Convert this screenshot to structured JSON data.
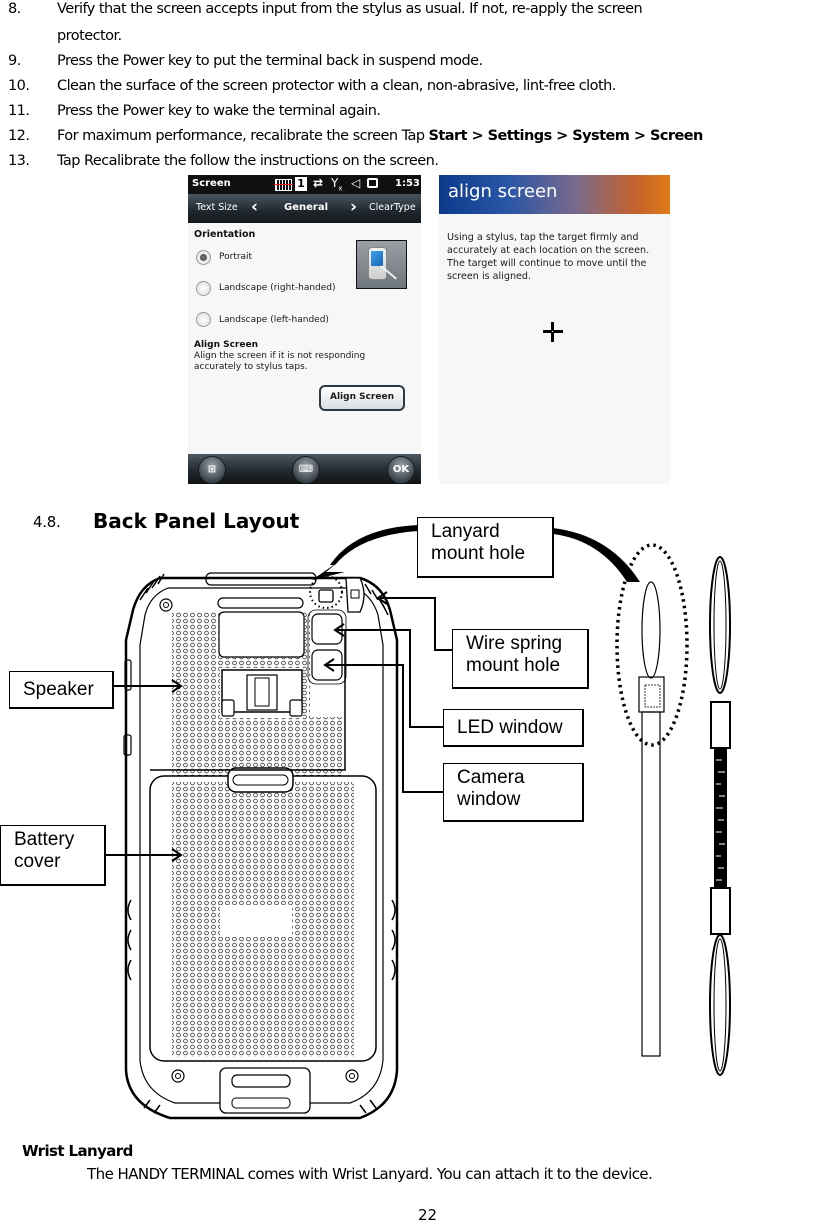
{
  "steps": [
    {
      "num": "8.",
      "lines": [
        "Verify that the screen accepts input from the stylus as usual. If not, re-apply the screen",
        "protector."
      ]
    },
    {
      "num": "9.",
      "text": "Press the Power key to put the terminal back in suspend mode."
    },
    {
      "num": "10.",
      "text": "Clean the surface of the screen protector with a clean, non-abrasive, lint-free cloth."
    },
    {
      "num": "11.",
      "text": "Press the Power key to wake the terminal again."
    },
    {
      "num": "12.",
      "text": "For maximum performance, recalibrate the screen Tap ",
      "bold": "Start > Settings > System > Screen"
    },
    {
      "num": "13.",
      "text": "Tap Recalibrate the follow the instructions on the screen."
    }
  ],
  "screen_settings": {
    "status_title": "Screen",
    "status_icons": [
      "battery-grid-icon",
      "sim-1-icon",
      "data-sync-icon",
      "no-signal-icon",
      "volume-icon",
      "power-plug-icon"
    ],
    "sim_label": "1",
    "time": "1:53",
    "tabs": {
      "prev": "Text Size",
      "current": "General",
      "next": "ClearType"
    },
    "orientation_heading": "Orientation",
    "options": [
      {
        "label": "Portrait",
        "selected": true
      },
      {
        "label": "Landscape (right-handed)",
        "selected": false
      },
      {
        "label": "Landscape (left-handed)",
        "selected": false
      }
    ],
    "align_heading": "Align Screen",
    "align_desc_1": "Align the screen if it is not responding",
    "align_desc_2": "accurately to stylus taps.",
    "align_button": "Align Screen",
    "bottom": {
      "ok": "OK"
    }
  },
  "screen_align": {
    "title": "align screen",
    "instructions": "Using a stylus, tap the target firmly and accurately at each location on the screen. The target will continue to move until the screen is aligned."
  },
  "section": {
    "number": "4.8.",
    "title": "Back Panel Layout"
  },
  "callouts": {
    "lanyard": [
      "Lanyard",
      "mount hole"
    ],
    "wire_spring": [
      "Wire spring",
      "mount hole"
    ],
    "speaker": [
      "Speaker"
    ],
    "led": [
      "LED window"
    ],
    "camera": [
      "Camera",
      "window"
    ],
    "battery": [
      "Battery",
      "cover"
    ]
  },
  "wrist_lanyard": {
    "title": "Wrist Lanyard",
    "body": "The HANDY TERMINAL comes with Wrist Lanyard. You can attach it to the device."
  },
  "page_number": "22"
}
